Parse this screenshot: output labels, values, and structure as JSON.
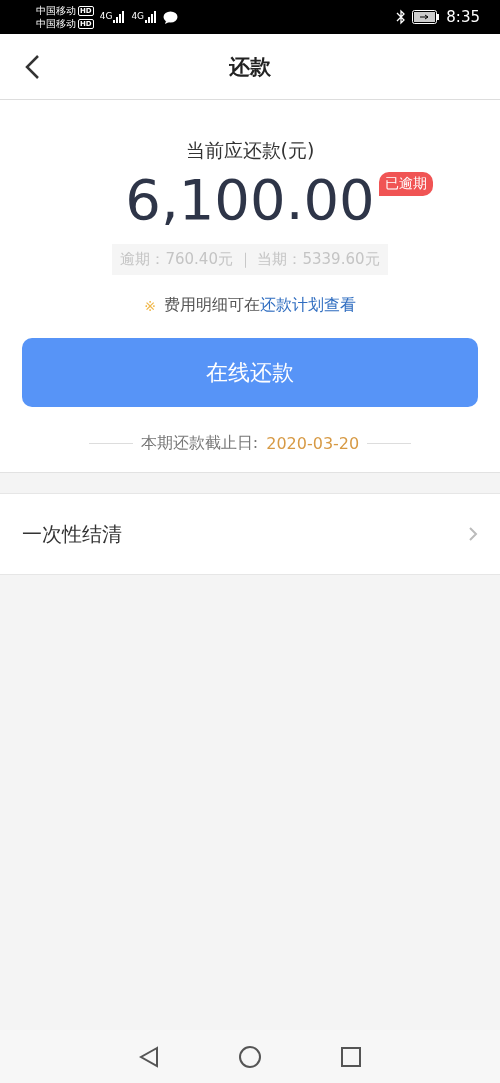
{
  "status_bar": {
    "carriers": [
      {
        "name": "中国移动",
        "badge": "HD"
      },
      {
        "name": "中国移动",
        "badge": "HD"
      }
    ],
    "networks": [
      "4G",
      "4G"
    ],
    "time": "8:35"
  },
  "header": {
    "title": "还款"
  },
  "summary": {
    "label": "当前应还款(元)",
    "amount": "6,100.00",
    "badge": "已逾期",
    "breakdown": "逾期：760.40元 ｜ 当期：5339.60元",
    "note_mark": "※",
    "note": "费用明细可在",
    "note_link": "还款计划查看",
    "button": "在线还款",
    "deadline_label": "本期还款截止日:",
    "deadline": "2020-03-20"
  },
  "options": [
    {
      "label": "一次性结清"
    }
  ]
}
